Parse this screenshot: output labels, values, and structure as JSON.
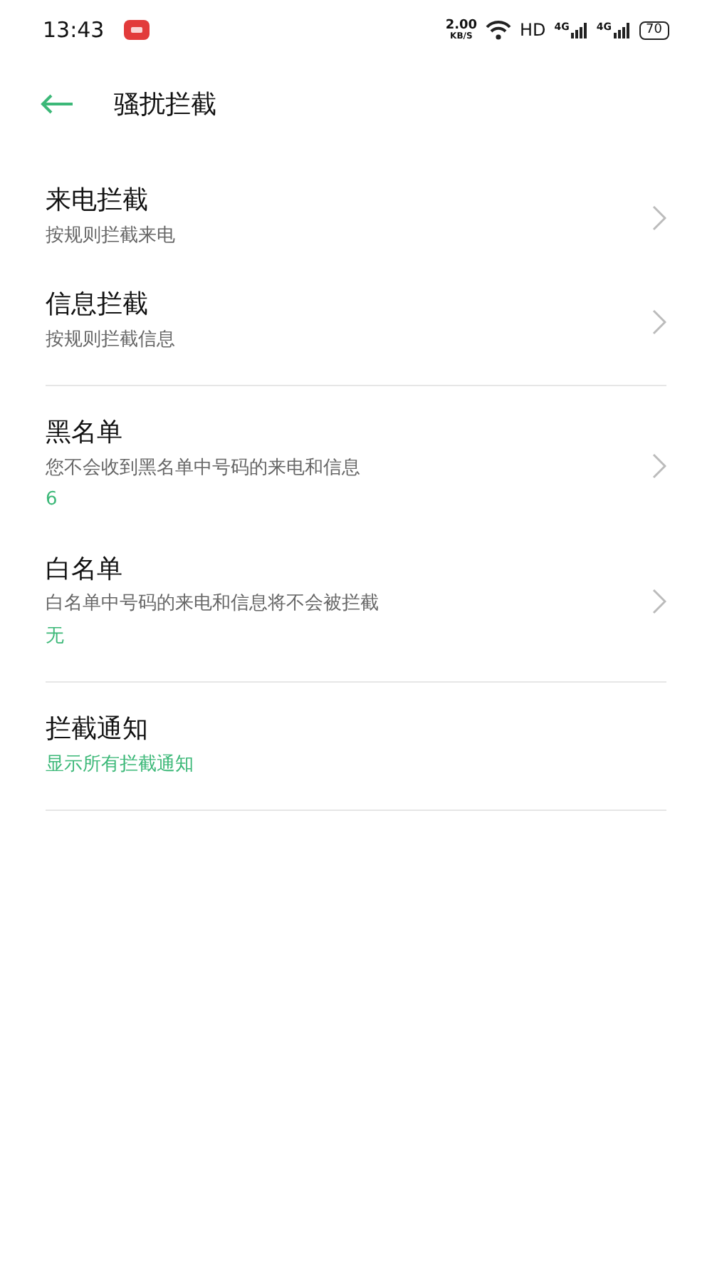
{
  "status_bar": {
    "time": "13:43",
    "speed_value": "2.00",
    "speed_unit": "KB/S",
    "hd": "HD",
    "networks": [
      "4G",
      "4G"
    ],
    "battery": "70"
  },
  "header": {
    "title": "骚扰拦截"
  },
  "sections": [
    {
      "items": [
        {
          "title": "来电拦截",
          "subtitle": "按规则拦截来电",
          "chevron": true
        },
        {
          "title": "信息拦截",
          "subtitle": "按规则拦截信息",
          "chevron": true
        }
      ]
    },
    {
      "items": [
        {
          "title": "黑名单",
          "subtitle": "您不会收到黑名单中号码的来电和信息",
          "value": "6",
          "chevron": true
        },
        {
          "title": "白名单",
          "subtitle": "白名单中号码的来电和信息将不会被拦截",
          "value": "无",
          "chevron": true
        }
      ]
    },
    {
      "items": [
        {
          "title": "拦截通知",
          "value": "显示所有拦截通知",
          "chevron": false
        }
      ]
    }
  ]
}
